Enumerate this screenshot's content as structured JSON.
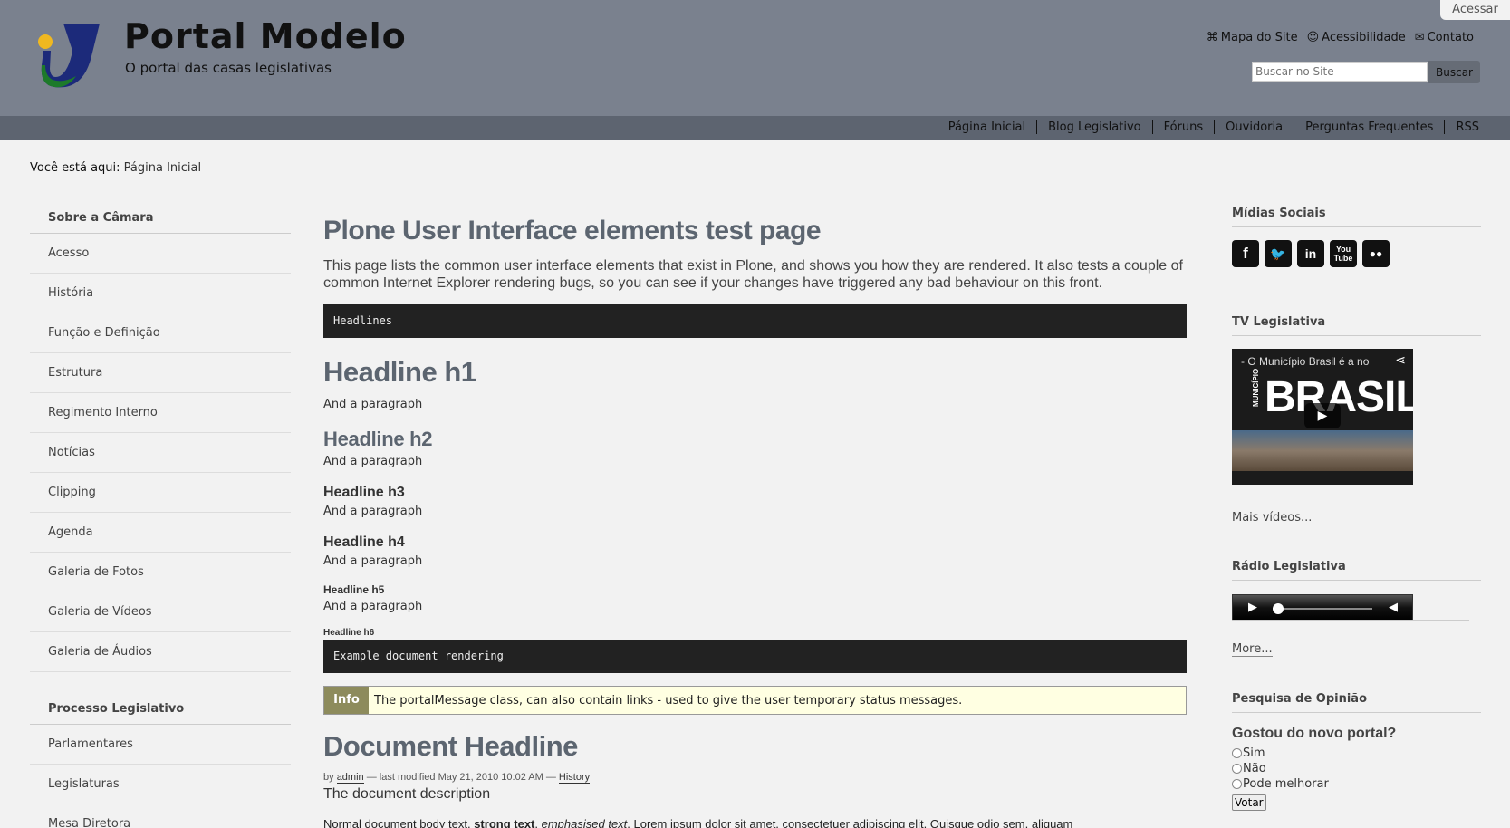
{
  "header": {
    "login": "Acessar",
    "title": "Portal Modelo",
    "subtitle": "O portal das casas legislativas",
    "site_actions": [
      "Mapa do Site",
      "Acessibilidade",
      "Contato"
    ],
    "search_placeholder": "Buscar no Site",
    "search_button": "Buscar"
  },
  "nav": [
    "Página Inicial",
    "Blog Legislativo",
    "Fóruns",
    "Ouvidoria",
    "Perguntas Frequentes",
    "RSS"
  ],
  "breadcrumb": {
    "prefix": "Você está aqui:",
    "current": "Página Inicial"
  },
  "left": {
    "section1_title": "Sobre a Câmara",
    "section1_items": [
      "Acesso",
      "História",
      "Função e Definição",
      "Estrutura",
      "Regimento Interno",
      "Notícias",
      "Clipping",
      "Agenda",
      "Galeria de Fotos",
      "Galeria de Vídeos",
      "Galeria de Áudios"
    ],
    "section2_title": "Processo Legislativo",
    "section2_items": [
      "Parlamentares",
      "Legislaturas",
      "Mesa Diretora"
    ]
  },
  "main": {
    "title": "Plone User Interface elements test page",
    "description": "This page lists the common user interface elements that exist in Plone, and shows you how they are rendered. It also tests a couple of common Internet Explorer rendering bugs, so you can see if your changes have triggered any bad behaviour on this front.",
    "code1": "Headlines",
    "h1": "Headline h1",
    "h2": "Headline h2",
    "h3": "Headline h3",
    "h4": "Headline h4",
    "h5": "Headline h5",
    "h6": "Headline h6",
    "paragraph": "And a paragraph",
    "code2": "Example document rendering",
    "info_label": "Info",
    "info_text_before": "The portalMessage class, can also contain",
    "info_link": "links",
    "info_text_after": "- used to give the user temporary status messages.",
    "doc_headline": "Document Headline",
    "byline_by": "by",
    "byline_author": "admin",
    "byline_modified": "— last modified May 21, 2010 10:02 AM —",
    "byline_history": "History",
    "doc_description": "The document description",
    "body_start": "Normal document body text,",
    "body_strong": "strong text",
    "body_em": "emphasised text",
    "body_rest": ". Lorem ipsum dolor sit amet, consectetuer adipiscing elit. Quisque odio sem, aliquam"
  },
  "right": {
    "social_title": "Mídias Sociais",
    "social_icons": [
      "facebook-icon",
      "twitter-icon",
      "linkedin-icon",
      "youtube-icon",
      "flickr-icon"
    ],
    "tv_title": "TV Legislativa",
    "video_caption": "- O Município Brasil é a no",
    "video_big": "BRASIL",
    "video_side": "MUNICÍPIO",
    "more_videos": "Mais vídeos...",
    "radio_title": "Rádio Legislativa",
    "more": "More...",
    "poll_title": "Pesquisa de Opinião",
    "poll_question": "Gostou do novo portal?",
    "poll_options": [
      "Sim",
      "Não",
      "Pode melhorar"
    ],
    "vote_button": "Votar"
  }
}
